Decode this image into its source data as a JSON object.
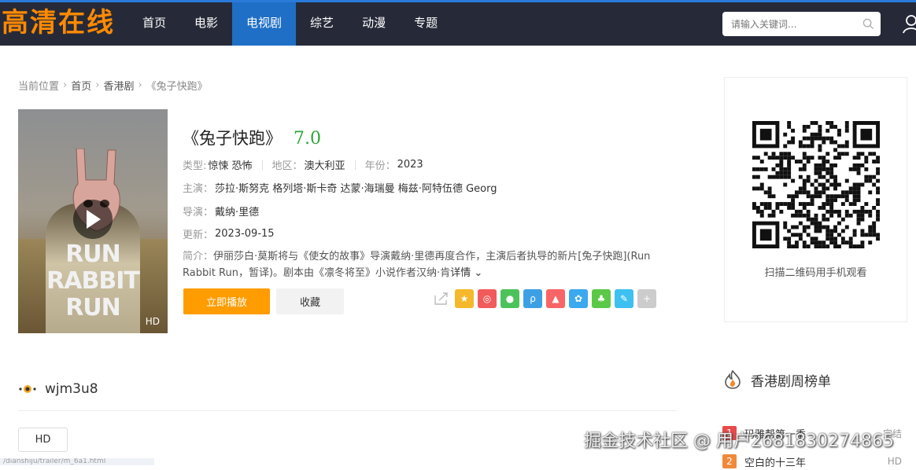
{
  "header": {
    "logo": "高清在线",
    "nav": [
      {
        "label": "首页",
        "active": false
      },
      {
        "label": "电影",
        "active": false
      },
      {
        "label": "电视剧",
        "active": true
      },
      {
        "label": "综艺",
        "active": false
      },
      {
        "label": "动漫",
        "active": false
      },
      {
        "label": "专题",
        "active": false
      }
    ],
    "search_placeholder": "请输入关键词...",
    "search_icon": "search-icon",
    "user_icon": "user-icon"
  },
  "breadcrumb": {
    "label": "当前位置",
    "items": [
      "首页",
      "香港剧"
    ],
    "current": "《兔子快跑》"
  },
  "poster": {
    "title_lines": [
      "RUN",
      "RABBIT",
      "RUN"
    ],
    "quality": "HD",
    "play_icon": "play-icon"
  },
  "detail": {
    "title": "《兔子快跑》",
    "score": "7.0",
    "type_label": "类型:",
    "type_value": "惊悚 恐怖",
    "region_label": "地区：",
    "region_value": "澳大利亚",
    "year_label": "年份：",
    "year_value": "2023",
    "actors_label": "主演：",
    "actors_value": "莎拉·斯努克 格列塔·斯卡奇 达蒙·海瑞曼 梅兹·阿特伍德 Georg",
    "director_label": "导演：",
    "director_value": "戴纳·里德",
    "updated_label": "更新：",
    "updated_value": "2023-09-15",
    "intro_label": "简介：",
    "intro_text": "伊丽莎白·莫斯将与《使女的故事》导演戴纳·里德再度合作，主演后者执导的新片[兔子快跑](Run Rabbit Run，暂译)。剧本由《凛冬将至》小说作者汉纳·肯",
    "more_label": "详情"
  },
  "actions": {
    "play_label": "立即播放",
    "fav_label": "收藏"
  },
  "share": [
    {
      "icon": "share-icon",
      "color": "#ffffff"
    },
    {
      "icon": "qzone-icon",
      "color": "#f5b82a"
    },
    {
      "icon": "weibo-icon",
      "color": "#f25b5b"
    },
    {
      "icon": "wechat-icon",
      "color": "#4cc35a"
    },
    {
      "icon": "tieba-icon",
      "color": "#3ea0e4"
    },
    {
      "icon": "qq-icon",
      "color": "#f96466"
    },
    {
      "icon": "baidu-icon",
      "color": "#3aa9f0"
    },
    {
      "icon": "clover-icon",
      "color": "#5bc847"
    },
    {
      "icon": "note-icon",
      "color": "#3ec0f0"
    },
    {
      "icon": "more-icon",
      "color": "#cccccc"
    }
  ],
  "qr": {
    "caption": "扫描二维码用手机观看"
  },
  "source": {
    "name": "wjm3u8",
    "episodes": [
      "HD"
    ]
  },
  "rank": {
    "title": "香港剧周榜单",
    "items": [
      {
        "num": "1",
        "name": "玛雅帮第一季",
        "tag": "完结",
        "color": "#e94a4a"
      },
      {
        "num": "2",
        "name": "空白的十三年",
        "tag": "HD",
        "color": "#f08a3a"
      }
    ]
  },
  "watermark": "掘金技术社区 @ 用户2681830274865",
  "status_url": "/dianshiju/trailer/m_6a1.html"
}
